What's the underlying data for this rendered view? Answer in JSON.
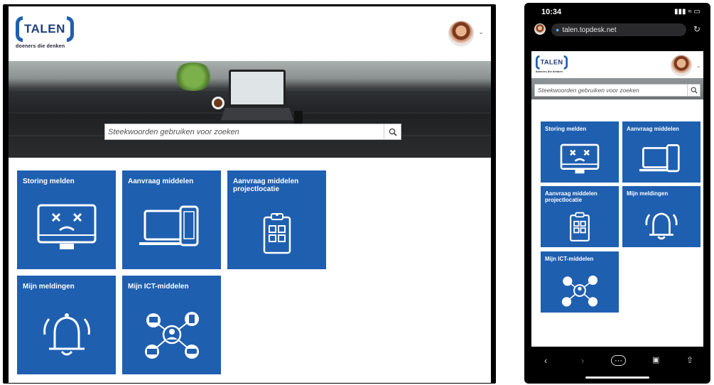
{
  "desktop": {
    "logo": {
      "word": "TALEN",
      "tagline": "doeners die denken"
    },
    "search": {
      "placeholder": "Steekwoorden gebruiken voor zoeken"
    },
    "tiles": [
      {
        "label": "Storing melden",
        "icon": "monitor-error-icon"
      },
      {
        "label": "Aanvraag middelen",
        "icon": "laptop-tablet-icon"
      },
      {
        "label": "Aanvraag middelen projectlocatie",
        "icon": "clipboard-icon"
      },
      {
        "label": "Mijn meldingen",
        "icon": "alarm-bell-icon"
      },
      {
        "label": "Mijn ICT-middelen",
        "icon": "user-network-icon"
      }
    ]
  },
  "phone": {
    "status": {
      "time": "10:34",
      "icons": "signal-wifi-battery"
    },
    "url": "talen.topdesk.net",
    "logo": {
      "word": "TALEN",
      "tagline": "doeners die denken"
    },
    "search": {
      "placeholder": "Steekwoorden gebruiken voor zoeken"
    },
    "tiles": [
      {
        "label": "Storing melden",
        "icon": "monitor-error-icon"
      },
      {
        "label": "Aanvraag middelen",
        "icon": "laptop-tablet-icon"
      },
      {
        "label": "Aanvraag middelen projectlocatie",
        "icon": "clipboard-icon"
      },
      {
        "label": "Mijn meldingen",
        "icon": "alarm-bell-icon"
      },
      {
        "label": "Mijn ICT-middelen",
        "icon": "user-network-icon"
      }
    ],
    "toolbar": [
      "back-icon",
      "forward-icon",
      "more-icon",
      "tabs-icon",
      "share-icon"
    ]
  },
  "colors": {
    "tile_blue": "#1f5fb0",
    "logo_blue": "#1f5fb0"
  }
}
